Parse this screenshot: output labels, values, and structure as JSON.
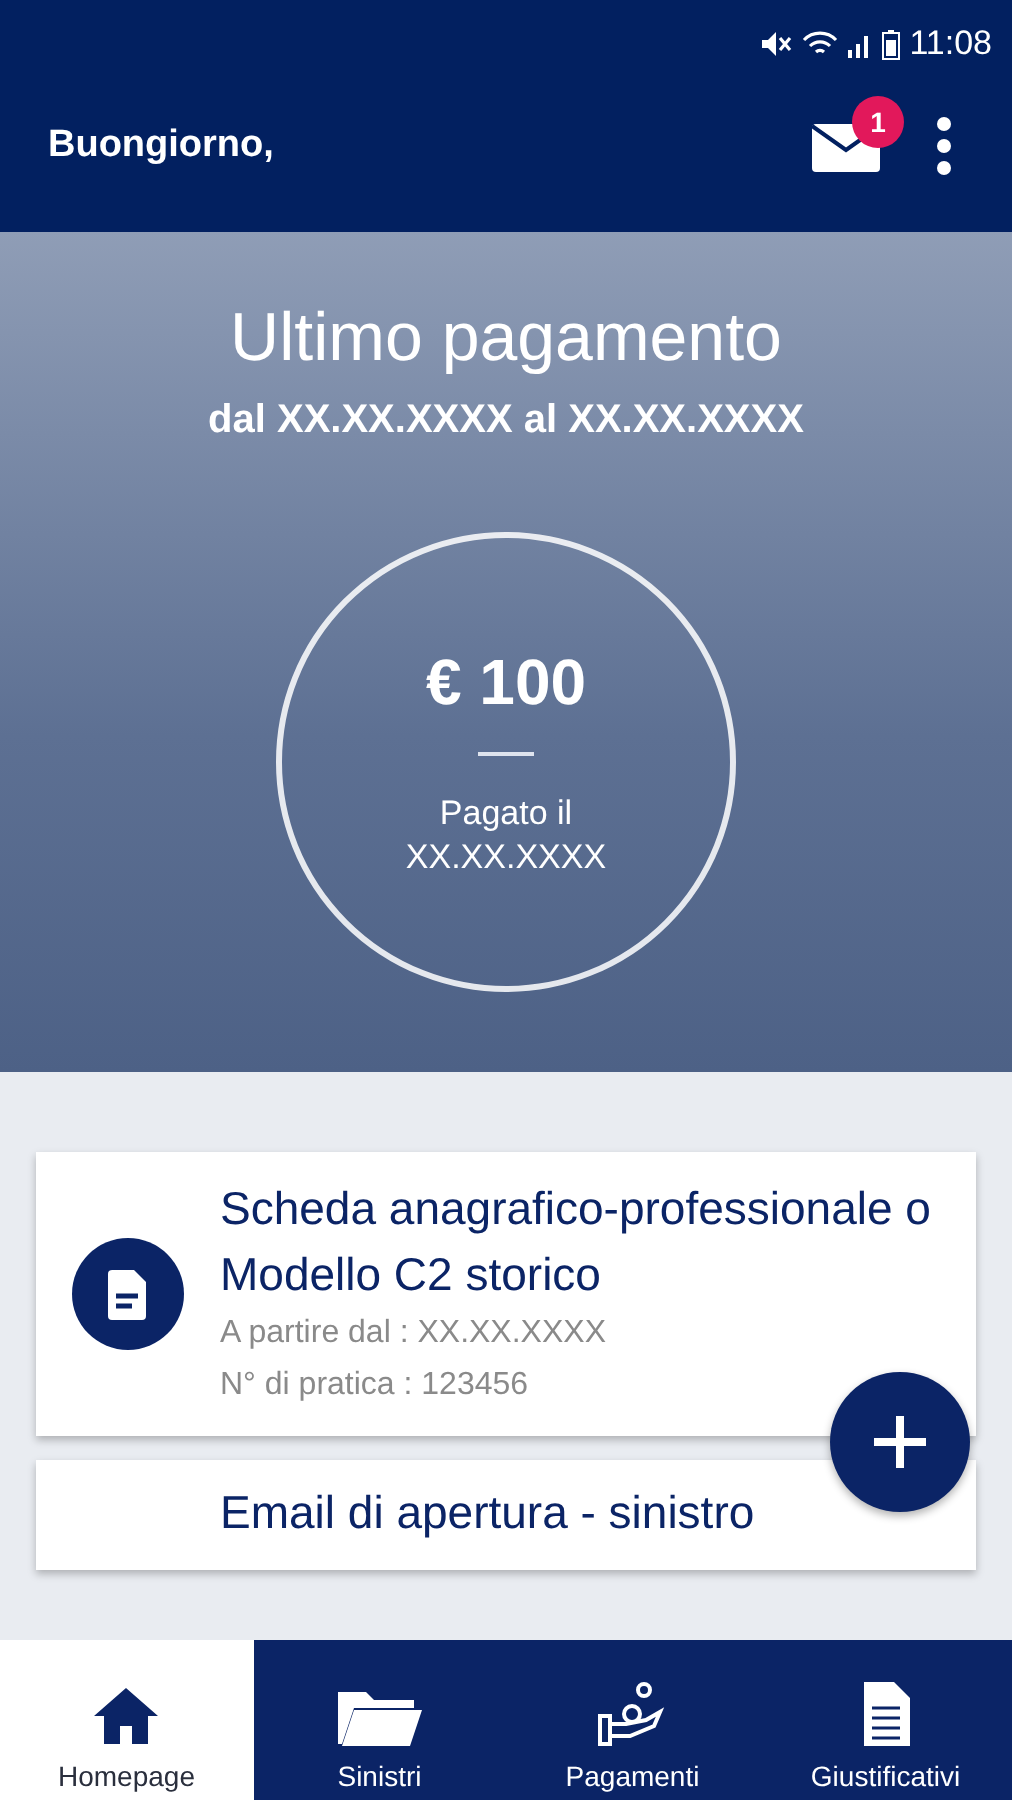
{
  "status_bar": {
    "time": "11:08"
  },
  "app_bar": {
    "greeting": "Buongiorno,",
    "mail_badge": "1"
  },
  "last_payment": {
    "title": "Ultimo pagamento",
    "period": "dal XX.XX.XXXX al XX.XX.XXXX",
    "amount": "€ 100",
    "paid_label": "Pagato il",
    "paid_date": "XX.XX.XXXX"
  },
  "cards": [
    {
      "title": "Scheda anagrafico-professionale o Modello C2 storico",
      "lines": [
        "A partire dal : XX.XX.XXXX",
        "N° di pratica : 123456"
      ]
    },
    {
      "title": "Email di apertura - sinistro"
    }
  ],
  "bottom_nav": [
    {
      "label": "Homepage",
      "kind": "home",
      "selected": true
    },
    {
      "label": "Sinistri",
      "kind": "folder",
      "selected": false
    },
    {
      "label": "Pagamenti",
      "kind": "payment",
      "selected": false
    },
    {
      "label": "Giustificativi",
      "kind": "document",
      "selected": false
    }
  ]
}
